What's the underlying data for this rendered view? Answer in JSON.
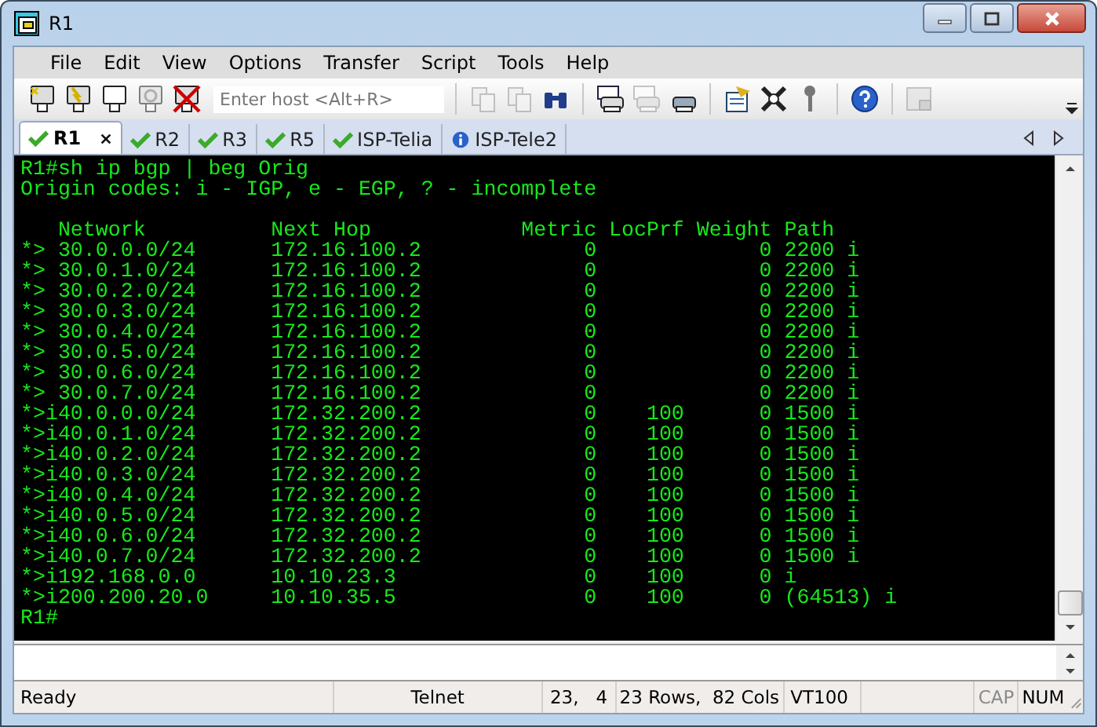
{
  "window": {
    "title": "R1"
  },
  "menu": [
    "File",
    "Edit",
    "View",
    "Options",
    "Transfer",
    "Script",
    "Tools",
    "Help"
  ],
  "toolbar": {
    "groups": [
      [
        {
          "kind": "connect",
          "disabled": false
        },
        {
          "kind": "quick-connect",
          "disabled": false
        },
        {
          "kind": "tab-connect",
          "disabled": false
        },
        {
          "kind": "reconnect",
          "disabled": true
        },
        {
          "kind": "disconnect",
          "disabled": false
        },
        {
          "kind": "host-field",
          "placeholder": "Enter host <Alt+R>"
        }
      ],
      [
        {
          "kind": "copy",
          "disabled": true
        },
        {
          "kind": "paste",
          "disabled": true
        },
        {
          "kind": "find",
          "disabled": false
        }
      ],
      [
        {
          "kind": "print-screen",
          "disabled": false
        },
        {
          "kind": "print-selection",
          "disabled": true
        },
        {
          "kind": "print",
          "disabled": false
        }
      ],
      [
        {
          "kind": "session-options",
          "disabled": false
        },
        {
          "kind": "global-options",
          "disabled": false
        },
        {
          "kind": "keymap",
          "disabled": false
        }
      ],
      [
        {
          "kind": "help",
          "disabled": false
        }
      ],
      [
        {
          "kind": "sftp",
          "disabled": true
        }
      ]
    ]
  },
  "tabs": [
    {
      "label": "R1",
      "selected": true,
      "kind": "connected"
    },
    {
      "label": "R2",
      "selected": false,
      "kind": "connected"
    },
    {
      "label": "R3",
      "selected": false,
      "kind": "connected"
    },
    {
      "label": "R5",
      "selected": false,
      "kind": "connected"
    },
    {
      "label": "ISP-Telia",
      "selected": false,
      "kind": "connected"
    },
    {
      "label": "ISP-Tele2",
      "selected": false,
      "kind": "info"
    }
  ],
  "terminal": {
    "command": "R1#sh ip bgp | beg Orig",
    "legend": "Origin codes: i - IGP, e - EGP, ? - incomplete",
    "header": "   Network          Next Hop            Metric LocPrf Weight Path",
    "rows": [
      "*> 30.0.0.0/24      172.16.100.2             0             0 2200 i",
      "*> 30.0.1.0/24      172.16.100.2             0             0 2200 i",
      "*> 30.0.2.0/24      172.16.100.2             0             0 2200 i",
      "*> 30.0.3.0/24      172.16.100.2             0             0 2200 i",
      "*> 30.0.4.0/24      172.16.100.2             0             0 2200 i",
      "*> 30.0.5.0/24      172.16.100.2             0             0 2200 i",
      "*> 30.0.6.0/24      172.16.100.2             0             0 2200 i",
      "*> 30.0.7.0/24      172.16.100.2             0             0 2200 i",
      "*>i40.0.0.0/24      172.32.200.2             0    100      0 1500 i",
      "*>i40.0.1.0/24      172.32.200.2             0    100      0 1500 i",
      "*>i40.0.2.0/24      172.32.200.2             0    100      0 1500 i",
      "*>i40.0.3.0/24      172.32.200.2             0    100      0 1500 i",
      "*>i40.0.4.0/24      172.32.200.2             0    100      0 1500 i",
      "*>i40.0.5.0/24      172.32.200.2             0    100      0 1500 i",
      "*>i40.0.6.0/24      172.32.200.2             0    100      0 1500 i",
      "*>i40.0.7.0/24      172.32.200.2             0    100      0 1500 i",
      "*>i192.168.0.0      10.10.23.3               0    100      0 i",
      "*>i200.200.20.0     10.10.35.5               0    100      0 (64513) i"
    ],
    "prompt": "R1#"
  },
  "status_bar": [
    {
      "kind": "text",
      "text": "Ready"
    },
    {
      "kind": "text",
      "text": "Telnet"
    },
    {
      "kind": "text",
      "text": "23,   4"
    },
    {
      "kind": "text",
      "text": "23 Rows,  82 Cols"
    },
    {
      "kind": "text",
      "text": "VT100"
    },
    {
      "kind": "empty"
    },
    {
      "kind": "indicator",
      "text": "CAP",
      "active": false
    },
    {
      "kind": "indicator",
      "text": "NUM",
      "active": true
    }
  ]
}
